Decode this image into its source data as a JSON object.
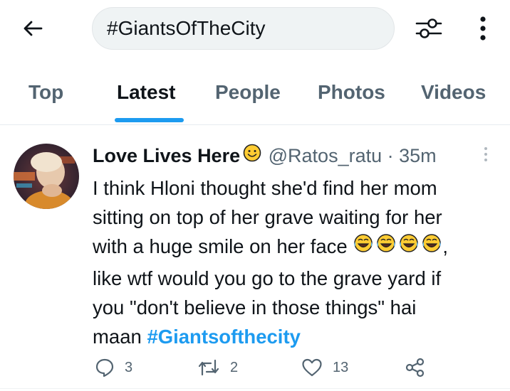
{
  "search": {
    "value": "#GiantsOfTheCity"
  },
  "tabs": [
    {
      "label": "Top"
    },
    {
      "label": "Latest"
    },
    {
      "label": "People"
    },
    {
      "label": "Photos"
    },
    {
      "label": "Videos"
    }
  ],
  "active_tab": "Latest",
  "tweet": {
    "display_name": "Love Lives Here",
    "handle": "@Ratos_ratu",
    "separator": "·",
    "time": "35m",
    "lines": [
      "I think Hloni thought she'd find her mom",
      "sitting on top of her grave waiting for her",
      "with a huge smile on her face",
      ",",
      "like wtf would you go to the grave yard if",
      "you \"don't believe in those things\" hai",
      "maan "
    ],
    "hashtag": "#Giantsofthecity",
    "replies": "3",
    "retweets": "2",
    "likes": "13"
  },
  "colors": {
    "accent": "#1d9bf0",
    "text_primary": "#0f1419",
    "text_secondary": "#536471",
    "search_bg": "#eff3f4"
  },
  "icons": {
    "back": "arrow-left-icon",
    "filter": "sliders-icon",
    "more": "kebab-vertical-icon",
    "name_emoji": "smiling-face-emoji",
    "laugh_emoji": "tears-of-joy-emoji",
    "reply": "speech-bubble-icon",
    "retweet": "retweet-icon",
    "like": "heart-icon",
    "share": "share-icon"
  }
}
